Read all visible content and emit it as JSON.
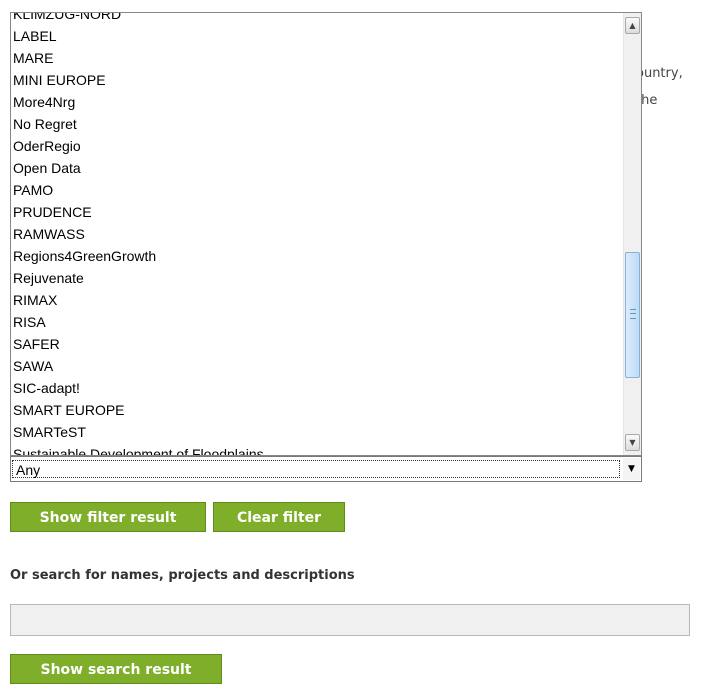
{
  "background": {
    "line1": "ountry,",
    "line2": "the"
  },
  "dropdown": {
    "items": [
      "KLIMZUG-NORD",
      "LABEL",
      "MARE",
      "MINI EUROPE",
      "More4Nrg",
      "No Regret",
      "OderRegio",
      "Open Data",
      "PAMO",
      "PRUDENCE",
      "RAMWASS",
      "Regions4GreenGrowth",
      "Rejuvenate",
      "RIMAX",
      "RISA",
      "SAFER",
      "SAWA",
      "SIC-adapt!",
      "SMART EUROPE",
      "SMARTeST",
      "Sustainable Development of Floodplains"
    ],
    "selected_value": "Any"
  },
  "buttons": {
    "show_filter": "Show filter result",
    "clear_filter": "Clear filter",
    "show_search": "Show search result"
  },
  "search": {
    "label": "Or search for names, projects and descriptions",
    "value": "",
    "placeholder": ""
  },
  "colors": {
    "button_bg": "#7fae2b",
    "scroll_thumb": "#bcdcf6"
  }
}
